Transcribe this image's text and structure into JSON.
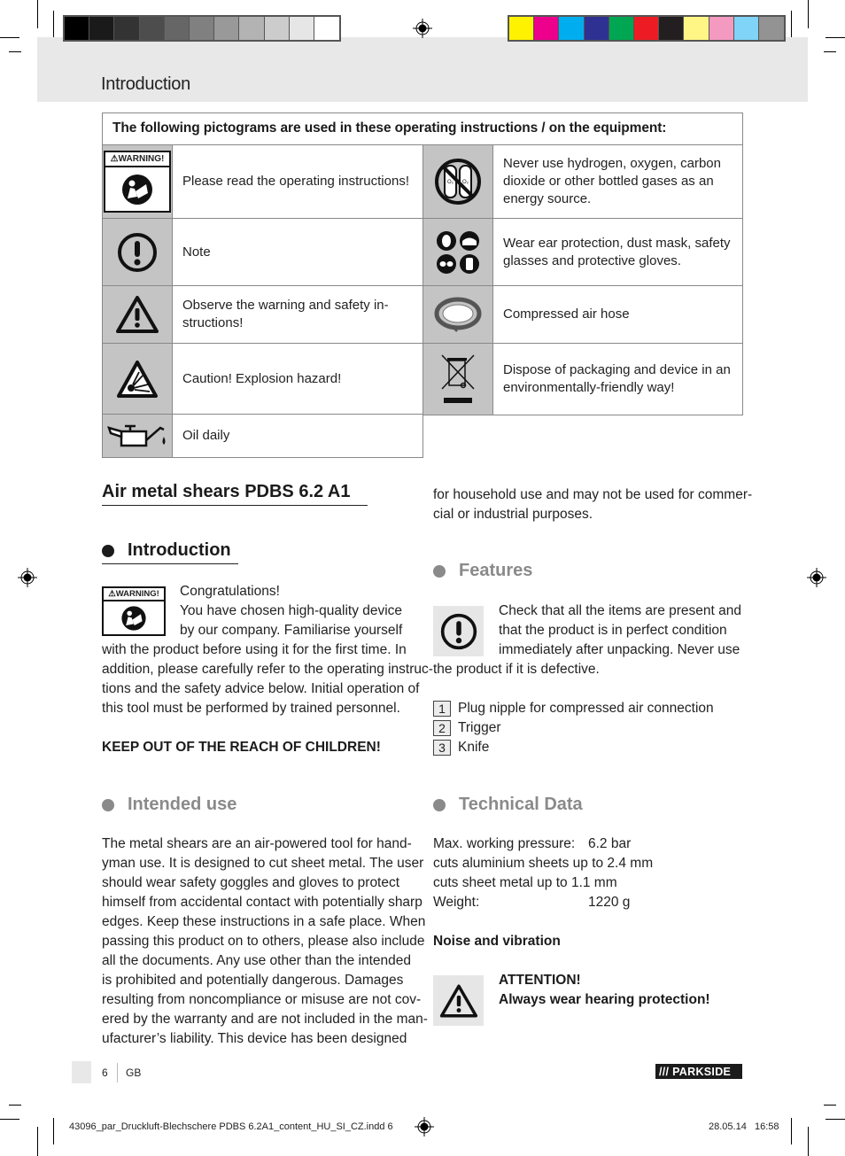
{
  "header": {
    "title": "Introduction",
    "grey_swatches": [
      "#000000",
      "#1a1a1a",
      "#333333",
      "#4d4d4d",
      "#666666",
      "#808080",
      "#999999",
      "#b3b3b3",
      "#cccccc",
      "#e6e6e6",
      "#ffffff"
    ],
    "color_swatches": [
      "#fff200",
      "#ec008c",
      "#00aeef",
      "#2e3192",
      "#00a651",
      "#ed1c24",
      "#231f20",
      "#fff685",
      "#f49ac1",
      "#7fd4f7",
      "#939393"
    ]
  },
  "pictograms": {
    "heading": "The following pictograms are used in these operating instructions / on the equipment:",
    "warning_label": "WARNING!",
    "left": [
      {
        "icon": "read-manual-warning-icon",
        "text": "Please read the operating instructions!"
      },
      {
        "icon": "note-exclamation-icon",
        "text": "Note"
      },
      {
        "icon": "warning-triangle-icon",
        "text": "Observe the warning and safety in-structions!"
      },
      {
        "icon": "explosion-hazard-icon",
        "text": "Caution! Explosion hazard!"
      },
      {
        "icon": "oil-can-icon",
        "text": "Oil daily"
      }
    ],
    "right": [
      {
        "icon": "no-bottled-gas-icon",
        "text": "Never use hydrogen, oxygen, carbon dioxide or other bottled gases as an energy source."
      },
      {
        "icon": "protective-equipment-icon",
        "text": "Wear ear protection, dust mask, safety glasses and protective gloves."
      },
      {
        "icon": "air-hose-icon",
        "text": "Compressed air hose"
      },
      {
        "icon": "weee-disposal-icon",
        "text": "Dispose of packaging and device in an environmentally-friendly way!"
      }
    ]
  },
  "left_column": {
    "product_title": "Air metal shears PDBS 6.2 A1",
    "introduction": {
      "heading": "Introduction",
      "warning_label": "WARNING!",
      "lines_beside_icon": [
        "Congratulations!",
        "You have chosen high-quality device",
        "by our company. Familiarise yourself"
      ],
      "lines": [
        "with the product before using it for the first time. In",
        "addition, please carefully refer to the operating instruc-",
        "tions and the safety advice below. Initial operation of",
        "this tool must be performed by trained personnel."
      ],
      "notice": "KEEP OUT OF THE REACH OF CHILDREN!"
    },
    "intended_use": {
      "heading": "Intended use",
      "lines": [
        "The metal shears are an air-powered tool for hand-",
        "yman use. It is designed to cut sheet metal. The user",
        "should wear safety goggles and gloves to protect",
        "himself from accidental contact with potentially sharp",
        "edges. Keep these instructions in a safe place. When",
        "passing this product on to others, please also include",
        "all the documents. Any use other than the intended",
        "is prohibited and potentially dangerous. Damages",
        "resulting from noncompliance or misuse are not cov-",
        "ered by the warranty and are not included in the man-",
        "ufacturer’s liability. This device has been designed"
      ]
    }
  },
  "right_column": {
    "continuation": [
      "for household use and may not be used for commer-",
      "cial or industrial purposes."
    ],
    "features": {
      "heading": "Features",
      "lines_beside_icon": [
        "Check that all the items are present and",
        "that the product is in perfect condition",
        "immediately after unpacking. Never use"
      ],
      "line_after": "the product if it is defective.",
      "items": [
        {
          "num": "1",
          "label": "Plug nipple for compressed air connection"
        },
        {
          "num": "2",
          "label": "Trigger"
        },
        {
          "num": "3",
          "label": "Knife"
        }
      ]
    },
    "technical_data": {
      "heading": "Technical Data",
      "rows": [
        {
          "label": "Max. working pressure:",
          "value": "6.2 bar"
        },
        {
          "label": "cuts aluminium sheets up to 2.4 mm",
          "value": ""
        },
        {
          "label": "cuts sheet metal up to 1.1 mm",
          "value": ""
        },
        {
          "label": "Weight:",
          "value": "1220 g"
        }
      ],
      "noise_heading": "Noise and vibration",
      "attention": "ATTENTION!",
      "attention_text": "Always wear hearing protection!"
    }
  },
  "footer": {
    "page_number": "6",
    "language": "GB",
    "brand": "/// PARKSIDE",
    "file_name": "43096_par_Druckluft-Blechschere PDBS 6.2A1_content_HU_SI_CZ.indd   6",
    "date": "28.05.14",
    "time": "16:58"
  }
}
